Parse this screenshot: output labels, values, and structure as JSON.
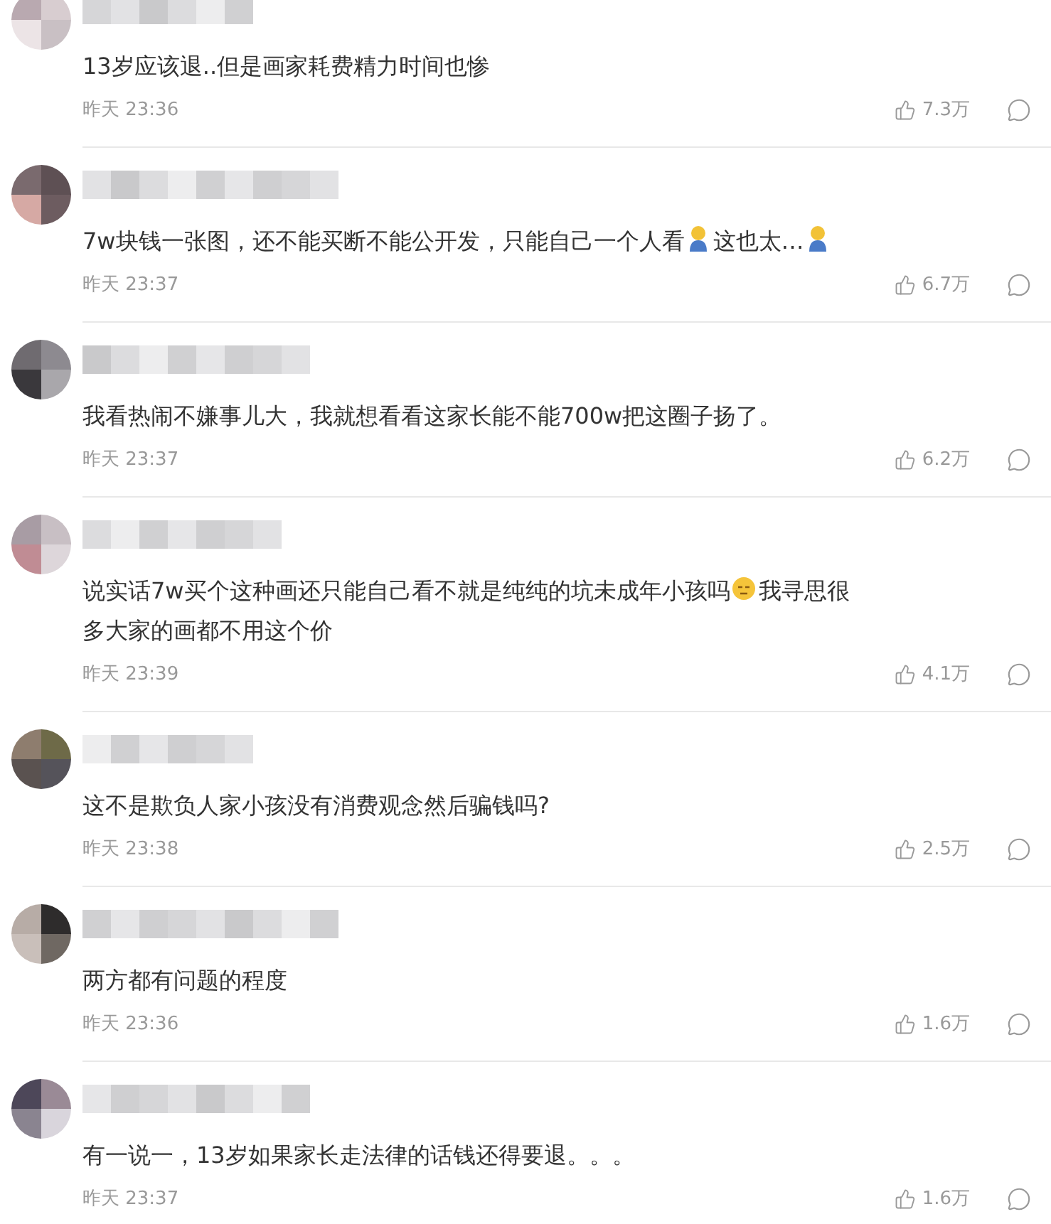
{
  "comments": [
    {
      "text": [
        {
          "kind": "text",
          "text": "13岁应该退..但是画家耗费精力时间也惨"
        }
      ],
      "time": "昨天 23:36",
      "likes": "7.3万"
    },
    {
      "text": [
        {
          "kind": "text",
          "text": "7w块钱一张图，还不能买断不能公开发，只能自己一个人看"
        },
        {
          "kind": "figure"
        },
        {
          "kind": "text",
          "text": "这也太…"
        },
        {
          "kind": "figure"
        }
      ],
      "time": "昨天 23:37",
      "likes": "6.7万"
    },
    {
      "text": [
        {
          "kind": "text",
          "text": "我看热闹不嫌事儿大，我就想看看这家长能不能700w把这圈子扬了。"
        }
      ],
      "time": "昨天 23:37",
      "likes": "6.2万"
    },
    {
      "text": [
        {
          "kind": "text",
          "text": "说实话7w买个这种画还只能自己看不就是纯纯的坑未成年小孩吗"
        },
        {
          "kind": "face"
        },
        {
          "kind": "text",
          "text": "我寻思很"
        },
        {
          "kind": "break"
        },
        {
          "kind": "text",
          "text": "多大家的画都不用这个价"
        }
      ],
      "time": "昨天 23:39",
      "likes": "4.1万"
    },
    {
      "text": [
        {
          "kind": "text",
          "text": "这不是欺负人家小孩没有消费观念然后骗钱吗?"
        }
      ],
      "time": "昨天 23:38",
      "likes": "2.5万"
    },
    {
      "text": [
        {
          "kind": "text",
          "text": "两方都有问题的程度"
        }
      ],
      "time": "昨天 23:36",
      "likes": "1.6万"
    },
    {
      "text": [
        {
          "kind": "text",
          "text": "有一说一，13岁如果家长走法律的话钱还得要退。。。"
        }
      ],
      "time": "昨天 23:37",
      "likes": "1.6万"
    }
  ]
}
